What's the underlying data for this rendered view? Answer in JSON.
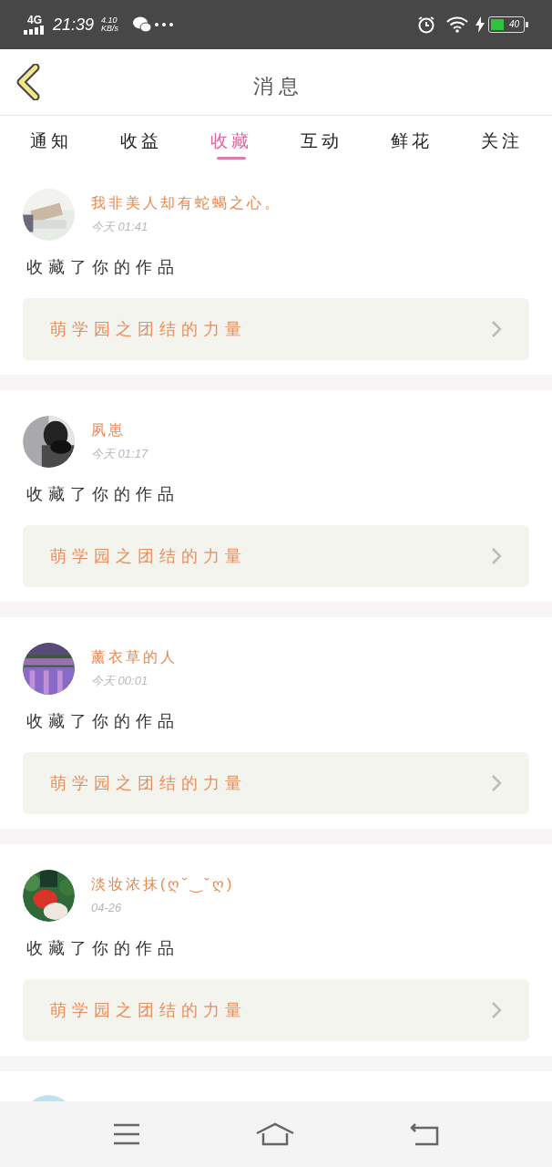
{
  "status_bar": {
    "network": "4G",
    "time": "21:39",
    "speed": "4.10",
    "speed_unit": "KB/s",
    "battery": "40"
  },
  "header": {
    "title": "消 息"
  },
  "tabs": [
    {
      "label": "通知",
      "selected": false
    },
    {
      "label": "收益",
      "selected": false
    },
    {
      "label": "收藏",
      "selected": true
    },
    {
      "label": "互动",
      "selected": false
    },
    {
      "label": "鲜花",
      "selected": false
    },
    {
      "label": "关注",
      "selected": false
    }
  ],
  "messages": [
    {
      "user": "我非美人却有蛇蝎之心。",
      "time": "今天 01:41",
      "action": "收藏了你的作品",
      "work": "萌学园之团结的力量"
    },
    {
      "user": "夙崽",
      "time": "今天 01:17",
      "action": "收藏了你的作品",
      "work": "萌学园之团结的力量"
    },
    {
      "user": "薰衣草的人",
      "time": "今天 00:01",
      "action": "收藏了你的作品",
      "work": "萌学园之团结的力量"
    },
    {
      "user": "淡妆浓抹(ღ˘‿˘ღ)",
      "time": "04-26",
      "action": "收藏了你的作品",
      "work": "萌学园之团结的力量"
    }
  ]
}
